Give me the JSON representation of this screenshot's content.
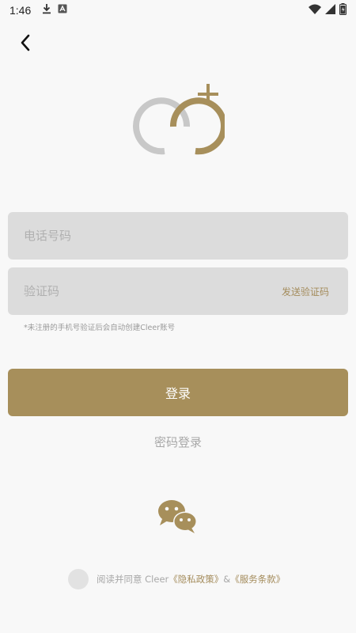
{
  "status_bar": {
    "time": "1:46"
  },
  "icons": {
    "back": "chevron-left-icon",
    "logo": "cleer-logo",
    "wechat": "wechat-icon"
  },
  "form": {
    "phone_placeholder": "电话号码",
    "code_placeholder": "验证码",
    "send_code_label": "发送验证码",
    "hint": "*未注册的手机号验证后会自动创建Cleer账号"
  },
  "actions": {
    "login_label": "登录",
    "password_login_label": "密码登录"
  },
  "agreement": {
    "prefix": "阅读并同意 Cleer",
    "privacy_link": "《隐私政策》",
    "separator": "&",
    "terms_link": "《服务条款》"
  },
  "colors": {
    "accent": "#a78f5b",
    "field_bg": "#dcdcdc",
    "background": "#f8f8f8"
  }
}
